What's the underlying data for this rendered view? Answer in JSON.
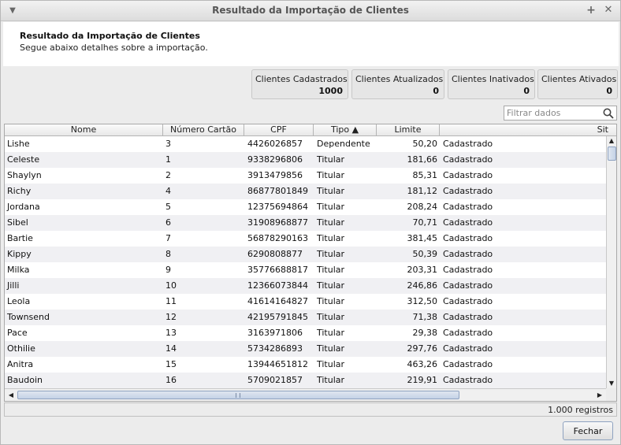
{
  "window": {
    "title": "Resultado da Importação de Clientes"
  },
  "header": {
    "title": "Resultado da Importação de Clientes",
    "subtitle": "Segue abaixo detalhes sobre a importação."
  },
  "stats": [
    {
      "label": "Clientes Cadastrados",
      "value": "1000"
    },
    {
      "label": "Clientes Atualizados",
      "value": "0"
    },
    {
      "label": "Clientes Inativados",
      "value": "0"
    },
    {
      "label": "Clientes Ativados",
      "value": "0"
    }
  ],
  "filter": {
    "placeholder": "Filtrar dados",
    "value": ""
  },
  "table": {
    "columns": [
      "Nome",
      "Número Cartão",
      "CPF",
      "Tipo ▲",
      "Limite",
      "Sit"
    ],
    "rows": [
      [
        "Lishe",
        "3",
        "4426026857",
        "Dependente",
        "50,20",
        "Cadastrado"
      ],
      [
        "Celeste",
        "1",
        "9338296806",
        "Titular",
        "181,66",
        "Cadastrado"
      ],
      [
        "Shaylyn",
        "2",
        "3913479856",
        "Titular",
        "85,31",
        "Cadastrado"
      ],
      [
        "Richy",
        "4",
        "86877801849",
        "Titular",
        "181,12",
        "Cadastrado"
      ],
      [
        "Jordana",
        "5",
        "12375694864",
        "Titular",
        "208,24",
        "Cadastrado"
      ],
      [
        "Sibel",
        "6",
        "31908968877",
        "Titular",
        "70,71",
        "Cadastrado"
      ],
      [
        "Bartie",
        "7",
        "56878290163",
        "Titular",
        "381,45",
        "Cadastrado"
      ],
      [
        "Kippy",
        "8",
        "6290808877",
        "Titular",
        "50,39",
        "Cadastrado"
      ],
      [
        "Milka",
        "9",
        "35776688817",
        "Titular",
        "203,31",
        "Cadastrado"
      ],
      [
        "Jilli",
        "10",
        "12366073844",
        "Titular",
        "246,86",
        "Cadastrado"
      ],
      [
        "Leola",
        "11",
        "41614164827",
        "Titular",
        "312,50",
        "Cadastrado"
      ],
      [
        "Townsend",
        "12",
        "42195791845",
        "Titular",
        "71,38",
        "Cadastrado"
      ],
      [
        "Pace",
        "13",
        "3163971806",
        "Titular",
        "29,38",
        "Cadastrado"
      ],
      [
        "Othilie",
        "14",
        "5734286893",
        "Titular",
        "297,76",
        "Cadastrado"
      ],
      [
        "Anitra",
        "15",
        "13944651812",
        "Titular",
        "463,26",
        "Cadastrado"
      ],
      [
        "Baudoin",
        "16",
        "5709021857",
        "Titular",
        "219,91",
        "Cadastrado"
      ]
    ]
  },
  "status": {
    "count": "1.000 registros"
  },
  "buttons": {
    "close": "Fechar"
  }
}
